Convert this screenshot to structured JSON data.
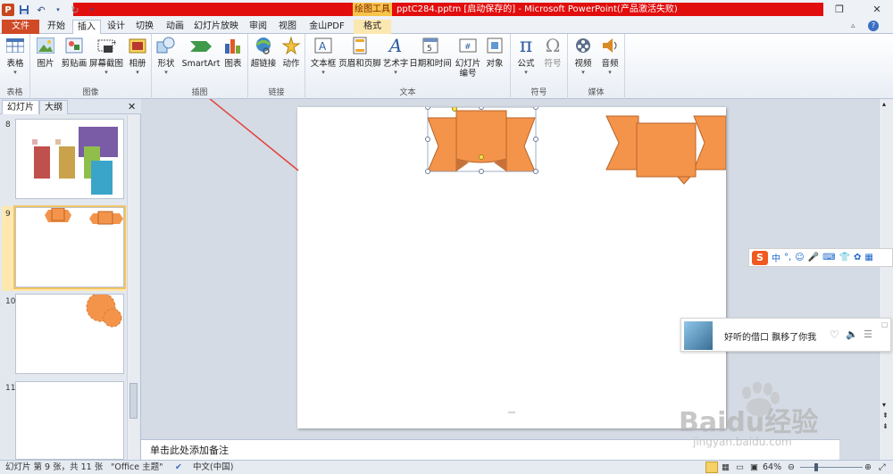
{
  "titlebar": {
    "context_tool": "绘图工具",
    "document_title": "pptC284.pptm [启动保存的] - Microsoft PowerPoint(产品激活失败)",
    "app_badge": "P"
  },
  "tabs": {
    "file": "文件",
    "items": [
      "开始",
      "插入",
      "设计",
      "切换",
      "动画",
      "幻灯片放映",
      "审阅",
      "视图",
      "金山PDF",
      "格式"
    ],
    "active": "插入"
  },
  "ribbon": {
    "groups": [
      {
        "label": "表格",
        "buttons": [
          "表格"
        ]
      },
      {
        "label": "图像",
        "buttons": [
          "图片",
          "剪贴画",
          "屏幕截图",
          "相册"
        ]
      },
      {
        "label": "插图",
        "buttons": [
          "形状",
          "SmartArt",
          "图表"
        ]
      },
      {
        "label": "链接",
        "buttons": [
          "超链接",
          "动作"
        ]
      },
      {
        "label": "文本",
        "buttons": [
          "文本框",
          "页眉和页脚",
          "艺术字",
          "日期和时间",
          "幻灯片编号",
          "对象"
        ]
      },
      {
        "label": "符号",
        "buttons": [
          "公式",
          "符号"
        ]
      },
      {
        "label": "媒体",
        "buttons": [
          "视频",
          "音频"
        ]
      }
    ],
    "slide_number_line1": "幻灯片",
    "slide_number_line2": "编号"
  },
  "pane": {
    "tab_slides": "幻灯片",
    "tab_outline": "大纲",
    "close": "✕",
    "slide_numbers": [
      "8",
      "9",
      "10",
      "11"
    ]
  },
  "notes": {
    "placeholder": "单击此处添加备注"
  },
  "status": {
    "slide_info": "幻灯片 第 9 张，共 11 张",
    "theme": "\"Office 主题\"",
    "language": "中文(中国)",
    "zoom": "64%"
  },
  "ime": {
    "items": [
      "中",
      "°,",
      "☺",
      "🎤",
      "⌨",
      "👕",
      "✿",
      "▦"
    ]
  },
  "music": {
    "song": "好听的借口 飘移了你我"
  },
  "watermark": {
    "brand": "Baidu经验",
    "url": "jingyan.baidu.com"
  },
  "colors": {
    "accent_red": "#e20d0d",
    "ribbon_orange": "#f4944a",
    "selection": "#f3c564"
  }
}
